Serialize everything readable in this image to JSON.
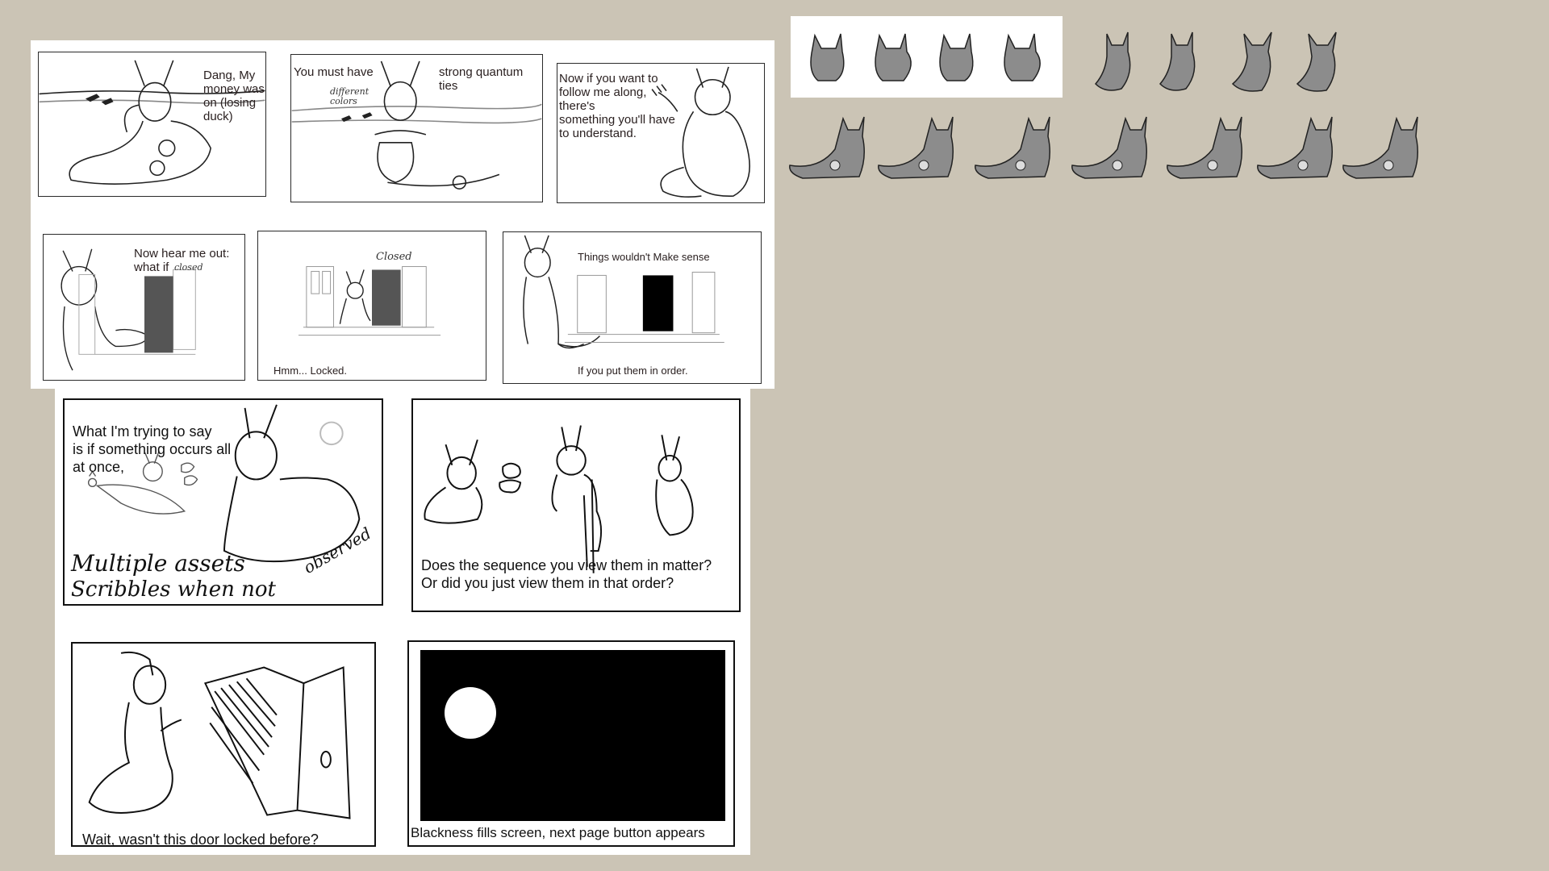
{
  "comic": {
    "p1": {
      "caption": "Dang, My\nmoney was\non (losing\nduck)"
    },
    "p2": {
      "caption_left": "You must have",
      "caption_right": "strong quantum ties",
      "note": "different\ncolors"
    },
    "p3": {
      "caption": "Now if you want to\nfollow me along,\nthere's\nsomething you'll have\nto understand."
    },
    "p4": {
      "caption": "Now hear me out:\nwhat if",
      "note": "closed"
    },
    "p5": {
      "caption": "Hmm... Locked.",
      "note": "Closed"
    },
    "p6": {
      "caption_top": "Things wouldn't Make sense",
      "caption_bottom": "If you put them in order."
    },
    "p7": {
      "caption": "What I'm trying to say\nis if something occurs all\nat once,",
      "hand1": "Multiple   assets",
      "hand2": "Scribbles  when  not",
      "hand3": "observed"
    },
    "p8": {
      "caption": "Does the sequence you view them in matter?\nOr did you just view them in that order?"
    },
    "p9": {
      "caption": "Wait, wasn't this door locked before?"
    },
    "p10": {
      "caption": "Blackness fills screen, next page button appears"
    }
  },
  "colors": {
    "background": "#cbc4b5",
    "paper": "#ffffff",
    "ink": "#111111",
    "sprite_fill": "#8c8c8c"
  }
}
